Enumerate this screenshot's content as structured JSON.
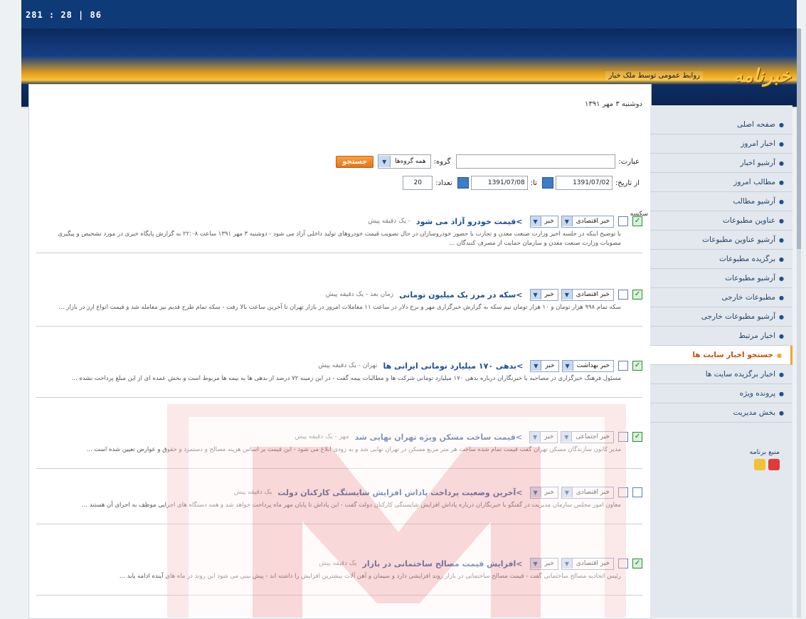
{
  "clock": "281 : 28 | 86",
  "banner": {
    "logo": "خبرنامه",
    "tagline": "روابط عمومی توسط ملک خبار"
  },
  "date": "دوشنبه ۳ مهر ۱۳۹۱",
  "search": {
    "phrase_label": "عبارت:",
    "phrase_value": "",
    "group_label": "گروه:",
    "group_value": "همه گروه‌ها",
    "search_button": "جستجو",
    "from_date_label": "از تاریخ:",
    "from_date": "1391/07/02",
    "to_label": "تا:",
    "to_date": "1391/07/08",
    "count_label": "تعداد:",
    "count_value": "20"
  },
  "items_label": "سکسه",
  "news": [
    {
      "category": "خبر اقتصادی",
      "type": "خبر",
      "checked": true,
      "title": ">قیمت خودرو آزاد می شود",
      "meta": "- یک دقیقه پیش",
      "snippet": "با توضیح اینکه در جلسه اخیر وزارت صنعت معدن و تجارت با حضور خودروسازان در حال تصویب قیمت خودروهای تولید داخلی آزاد می شود - دوشنبه ۳ مهر ۱۳۹۱ ساعت ۲۲:۰۸ به گزارش پایگاه خبری در مورد تشخیص و پیگیری مصوبات وزارت صنعت معدن و سازمان حمایت از مصرف کنندگان ..."
    },
    {
      "category": "خبر اقتصادی",
      "type": "خبر",
      "checked": true,
      "title": ">سکه در مرز یک میلیون تومانی",
      "meta": "زمان بعد - یک دقیقه پیش",
      "snippet": "سکه تمام ۹۹۸ هزار تومان و ۱۰ هزار تومان نیم سکه به گزارش خبرگزاری مهر و نرخ دلار در ساعت ۱۱ معاملات امروز در بازار تهران تا آخرین ساعت بالا رفت - سکه تمام طرح قدیم نیز معامله شد و قیمت انواع ارز در بازار ..."
    },
    {
      "category": "خبر بهداشت",
      "type": "خبر",
      "checked": true,
      "title": ">بدهی ۱۷۰ میلیارد تومانی ایرانی ها",
      "meta": "تهران - یک دقیقه پیش",
      "snippet": "مسئول فرهنگ خبرگزاری در مصاحبه با خبرنگاران درباره بدهی ۱۷۰ میلیارد تومانی شرکت ها و مطالبات بیمه گفت - در این زمینه ۷۲ درصد از بدهی ها به بیمه ها مربوط است و بخش عمده ای از این مبلغ پرداخت نشده ..."
    },
    {
      "category": "خبر اجتماعی",
      "type": "خبر",
      "checked": true,
      "title": ">قیمت ساخت مسکن ویژه تهران نهایی شد",
      "meta": "مهر - یک دقیقه پیش",
      "snippet": "مدیر کانون سازندگان مسکن تهران گفت قیمت تمام شده ساخت هر متر مربع مسکن در تهران نهایی شد و به زودی ابلاغ می شود - این قیمت بر اساس هزینه مصالح و دستمزد و حقوق و عوارض تعیین شده است ..."
    },
    {
      "category": "خبر اقتصادی",
      "type": "خبر",
      "checked": false,
      "title": ">آخرین وضعیت پرداخت پاداش افزایش شایستگی کارکنان دولت",
      "meta": "یک دقیقه پیش",
      "snippet": "معاون امور مجلس سازمان مدیریت در گفتگو با خبرنگاران درباره پاداش افزایش شایستگی کارکنان دولت گفت - این پاداش تا پایان مهر ماه پرداخت خواهد شد و همه دستگاه های اجرایی موظف به اجرای آن هستند ..."
    },
    {
      "category": "خبر اقتصادی",
      "type": "خبر",
      "checked": true,
      "title": ">افزایش قیمت مصالح ساختمانی در بازار",
      "meta": "یک دقیقه پیش",
      "snippet": "رئیس اتحادیه مصالح ساختمانی گفت - قیمت مصالح ساختمانی در بازار روند افزایشی دارد و سیمان و آهن آلات بیشترین افزایش را داشته اند - پیش بینی می شود این روند در ماه های آینده ادامه یابد ..."
    }
  ],
  "sidebar": {
    "items": [
      {
        "label": "صفحه اصلی"
      },
      {
        "label": "اخبار امروز"
      },
      {
        "label": "آرشیو اخبار"
      },
      {
        "label": "مطالب امروز"
      },
      {
        "label": "آرشیو مطالب"
      },
      {
        "label": "عناوین مطبوعات"
      },
      {
        "label": "آرشیو عناوین مطبوعات"
      },
      {
        "label": "برگزیده مطبوعات"
      },
      {
        "label": "آرشیو مطبوعات"
      },
      {
        "label": "مطبوعات خارجی"
      },
      {
        "label": "آرشیو مطبوعات خارجی"
      },
      {
        "label": "اخبار مرتبط"
      },
      {
        "label": "جستجو اخبار سایت ها"
      },
      {
        "label": "اخبار برگزیده سایت ها"
      },
      {
        "label": "پرونده ویژه"
      },
      {
        "label": "بخش مدیریت"
      }
    ],
    "active_index": 12,
    "rss_label": "منبع برنامه"
  },
  "colors": {
    "accent_orange": "#f5a623",
    "link_blue": "#1d4f95",
    "header_dark": "#0f3a78"
  }
}
